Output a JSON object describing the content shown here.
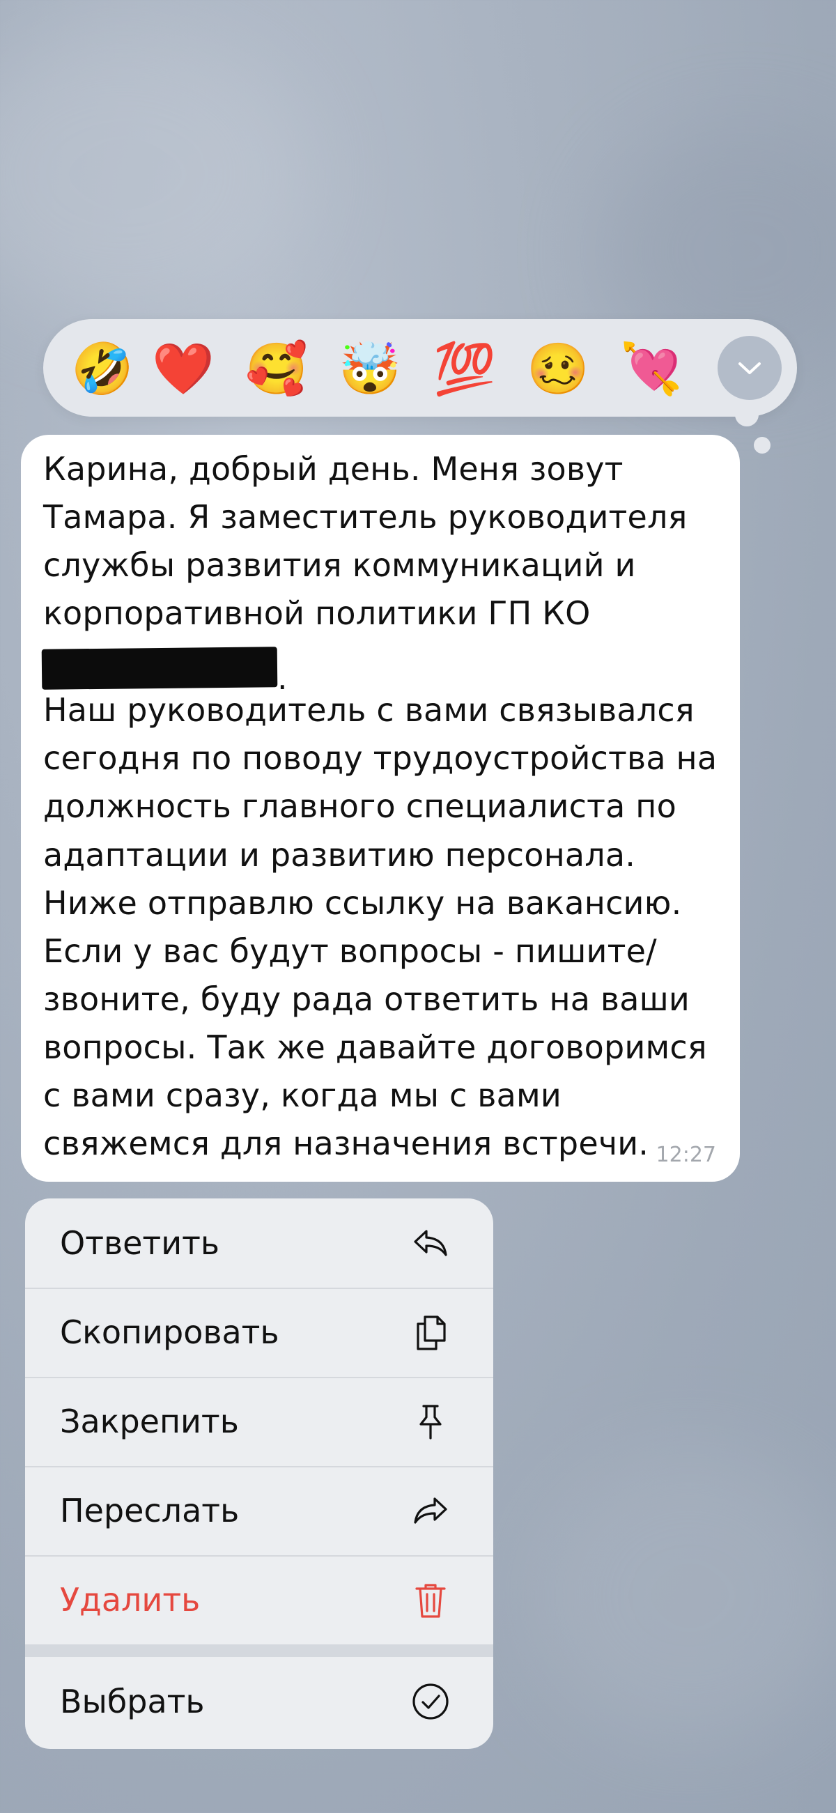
{
  "reactions": {
    "items": [
      {
        "name": "rolling-on-floor-laughing",
        "emoji": "🤣"
      },
      {
        "name": "red-heart",
        "emoji": "❤️"
      },
      {
        "name": "smiling-face-with-hearts",
        "emoji": "🥰"
      },
      {
        "name": "exploding-head",
        "emoji": "🤯"
      },
      {
        "name": "hundred-points",
        "emoji": "💯"
      },
      {
        "name": "woozy-face",
        "emoji": "🥴"
      },
      {
        "name": "heart-with-arrow",
        "emoji": "💘"
      }
    ],
    "expand_icon": "chevron-down-icon"
  },
  "message": {
    "lines": [
      "Карина, добрый день. Меня зовут",
      "Тамара. Я заместитель руководителя",
      "службы развития коммуникаций и",
      "корпоративной политики ГП КО",
      ".",
      "Наш руководитель с вами связывался",
      "сегодня по поводу трудоустройства на",
      "должность главного специалиста по",
      "адаптации и развитию персонала.",
      "Ниже отправлю ссылку на вакансию.",
      "Если у вас будут вопросы - пишите/",
      "звоните, буду рада ответить на ваши",
      "вопросы. Так же давайте договоримся",
      "с вами сразу, когда мы с вами",
      "свяжемся для назначения встречи."
    ],
    "time": "12:27"
  },
  "menu": {
    "reply": {
      "label": "Ответить",
      "icon": "reply-icon"
    },
    "copy": {
      "label": "Скопировать",
      "icon": "copy-icon"
    },
    "pin": {
      "label": "Закрепить",
      "icon": "pin-icon"
    },
    "forward": {
      "label": "Переслать",
      "icon": "forward-icon"
    },
    "delete": {
      "label": "Удалить",
      "icon": "trash-icon"
    },
    "select": {
      "label": "Выбрать",
      "icon": "checkmark-circle-icon"
    }
  },
  "colors": {
    "danger": "#e5483f",
    "bubble": "#ffffff",
    "menu_bg": "#eceef1"
  }
}
